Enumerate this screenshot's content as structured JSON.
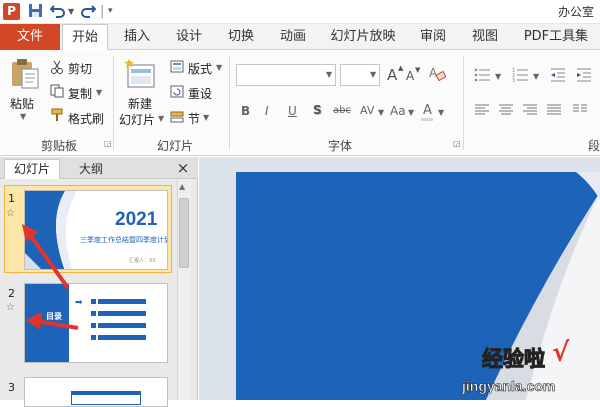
{
  "window": {
    "title": "办公室"
  },
  "tabs": {
    "file": "文件",
    "items": [
      "开始",
      "插入",
      "设计",
      "切换",
      "动画",
      "幻灯片放映",
      "审阅",
      "视图",
      "PDF工具集"
    ]
  },
  "ribbon": {
    "clipboard": {
      "paste": "粘贴",
      "cut": "剪切",
      "copy": "复制",
      "format_painter": "格式刷",
      "group_label": "剪贴板"
    },
    "slides": {
      "new_slide_line1": "新建",
      "new_slide_line2": "幻灯片",
      "layout": "版式",
      "reset": "重设",
      "section": "节",
      "group_label": "幻灯片"
    },
    "font": {
      "bold": "B",
      "italic": "I",
      "underline": "U",
      "shadow": "S",
      "strike": "abc",
      "spacing": "AV",
      "case": "Aa",
      "grow": "A",
      "shrink": "A",
      "group_label": "字体"
    },
    "paragraph": {
      "group_label": "段"
    }
  },
  "left_panel": {
    "tabs": [
      "幻灯片",
      "大纲"
    ],
    "close": "×",
    "slides": [
      {
        "number": "1",
        "year": "2021",
        "subtitle": "三季度工作总结暨四季度计划",
        "presenter": "汇报人：XX"
      },
      {
        "number": "2",
        "title": "目录"
      },
      {
        "number": "3"
      }
    ]
  },
  "watermark": {
    "title": "经验啦",
    "check": "√",
    "url": "jingyanla.com"
  },
  "colors": {
    "accent": "#d24726",
    "slide_blue": "#1d63b8",
    "selection": "#fde6a8",
    "arrow_red": "#e5332a"
  }
}
